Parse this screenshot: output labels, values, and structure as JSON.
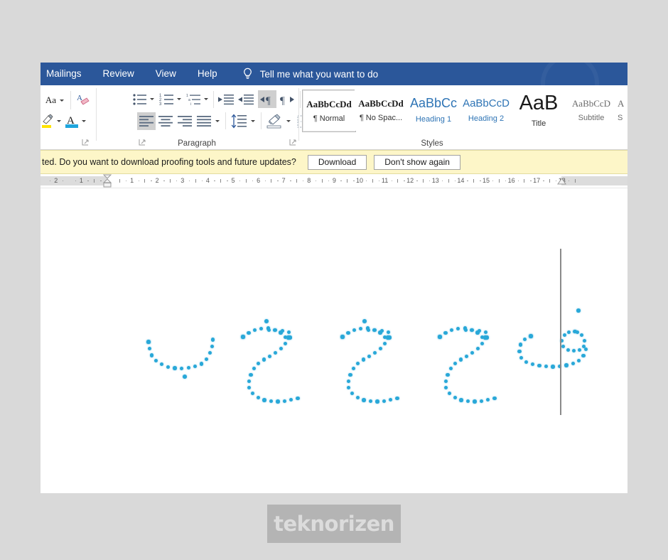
{
  "menu": {
    "items": [
      {
        "label": "Mailings"
      },
      {
        "label": "Review"
      },
      {
        "label": "View"
      },
      {
        "label": "Help"
      }
    ],
    "tell_me": "Tell me what you want to do",
    "bulb_icon": "lightbulb-icon"
  },
  "ribbon": {
    "font_group": {
      "change_case_label": "Aa",
      "clear_formatting_icon": "clear-formatting-icon",
      "text_highlight_icon": "text-highlight-color-icon",
      "font_color_icon": "font-color-icon"
    },
    "paragraph_group": {
      "label": "Paragraph",
      "bullets_icon": "bullet-list-icon",
      "numbering_icon": "numbered-list-icon",
      "multilevel_icon": "multilevel-list-icon",
      "decrease_indent_icon": "decrease-indent-icon",
      "increase_indent_icon": "increase-indent-icon",
      "ltr_icon": "left-to-right-text-icon",
      "rtl_icon": "right-to-left-text-icon",
      "sort_icon": "sort-icon",
      "show_marks_icon": "show-formatting-marks-icon",
      "align_left_icon": "align-left-icon",
      "align_center_icon": "align-center-icon",
      "align_right_icon": "align-right-icon",
      "justify_icon": "justify-icon",
      "line_spacing_icon": "line-spacing-icon",
      "shading_icon": "shading-icon",
      "borders_icon": "borders-icon",
      "dialog_launcher_icon": "dialog-launcher-icon"
    },
    "styles_group": {
      "label": "Styles",
      "dialog_launcher_icon": "dialog-launcher-icon",
      "items": [
        {
          "preview": "AaBbCcDd",
          "name": "¶ Normal",
          "selected": true,
          "style": "normal"
        },
        {
          "preview": "AaBbCcDd",
          "name": "¶ No Spac...",
          "selected": false,
          "style": "nospacing"
        },
        {
          "preview": "AaBbCc",
          "name": "Heading 1",
          "selected": false,
          "style": "heading1"
        },
        {
          "preview": "AaBbCcD",
          "name": "Heading 2",
          "selected": false,
          "style": "heading2"
        },
        {
          "preview": "AaB",
          "name": "Title",
          "selected": false,
          "style": "title"
        },
        {
          "preview": "AaBbCcD",
          "name": "Subtitle",
          "selected": false,
          "style": "subtitle"
        },
        {
          "preview": "A",
          "name": "S",
          "selected": false,
          "style": "cutoff"
        }
      ]
    }
  },
  "notification": {
    "message": "ted. Do you want to download proofing tools and future updates?",
    "download_label": "Download",
    "dismiss_label": "Don't show again"
  },
  "ruler": {
    "left_labels": [
      "2",
      "1"
    ],
    "labels": [
      "1",
      "2",
      "3",
      "4",
      "5",
      "6",
      "7",
      "8",
      "9",
      "10",
      "11",
      "12",
      "13",
      "14",
      "15",
      "16",
      "17",
      "18"
    ],
    "left_indent_marker": "indent-marker-icon",
    "right_indent_marker": "right-indent-marker-icon"
  },
  "document": {
    "content_description": "Dotted Arabic letter tracing worksheet",
    "letters": [
      {
        "name": "baa",
        "glyph": "ب"
      },
      {
        "name": "khaa",
        "glyph": "خ"
      },
      {
        "name": "jeem",
        "glyph": "ج"
      },
      {
        "name": "haa",
        "glyph": "ح"
      },
      {
        "name": "faa",
        "glyph": "ف"
      }
    ],
    "dot_color": "#29a8d8",
    "cursor_icon": "text-cursor-line"
  },
  "watermark": {
    "text": "teknorizen"
  },
  "colors": {
    "titlebar": "#2b579a",
    "notification_bg": "#fdf6c8",
    "page_bg": "#ffffff",
    "desktop_bg": "#d9d9d9",
    "accent_dots": "#29a8d8"
  }
}
